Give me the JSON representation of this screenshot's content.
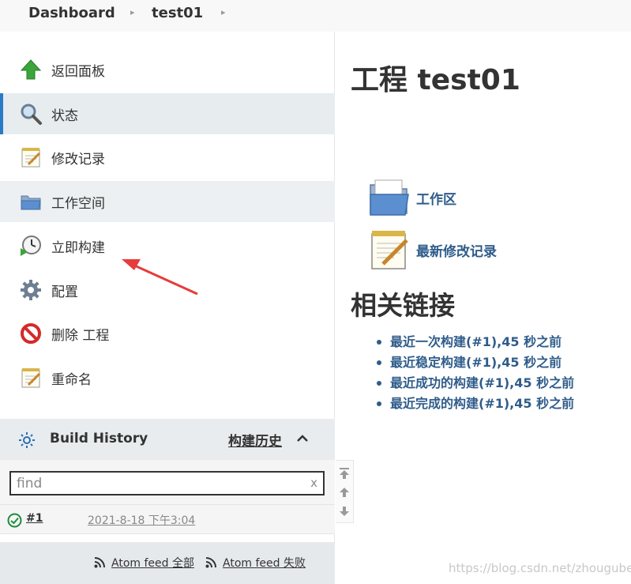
{
  "breadcrumb": {
    "items": [
      "Dashboard",
      "test01"
    ]
  },
  "sidebar": {
    "items": [
      {
        "label": "返回面板",
        "icon": "up-arrow-icon"
      },
      {
        "label": "状态",
        "icon": "search-icon"
      },
      {
        "label": "修改记录",
        "icon": "notepad-icon"
      },
      {
        "label": "工作空间",
        "icon": "folder-icon"
      },
      {
        "label": "立即构建",
        "icon": "clock-icon"
      },
      {
        "label": "配置",
        "icon": "gear-icon"
      },
      {
        "label": "删除 工程",
        "icon": "no-entry-icon"
      },
      {
        "label": "重命名",
        "icon": "notepad-icon"
      }
    ]
  },
  "build_history": {
    "title": "Build History",
    "title_cn": "构建历史",
    "search_value": "find",
    "search_clear": "x",
    "builds": [
      {
        "number": "#1",
        "time": "2021-8-18 下午3:04",
        "status": "success"
      }
    ],
    "feeds": [
      "Atom feed 全部",
      "Atom feed 失败"
    ]
  },
  "main": {
    "title": "工程 test01",
    "links": [
      {
        "label": "工作区",
        "icon": "folder-icon"
      },
      {
        "label": "最新修改记录",
        "icon": "notepad-icon"
      }
    ],
    "related_title": "相关链接",
    "related_links": [
      "最近一次构建(#1),45 秒之前",
      "最近稳定构建(#1),45 秒之前",
      "最近成功的构建(#1),45 秒之前",
      "最近完成的构建(#1),45 秒之前"
    ]
  },
  "watermark": "https://blog.csdn.net/zhougubei",
  "colors": {
    "accent": "#2a7ac8",
    "link": "#2f5c8a",
    "arrow": "#e63c3c",
    "success": "#1e8a3c"
  }
}
